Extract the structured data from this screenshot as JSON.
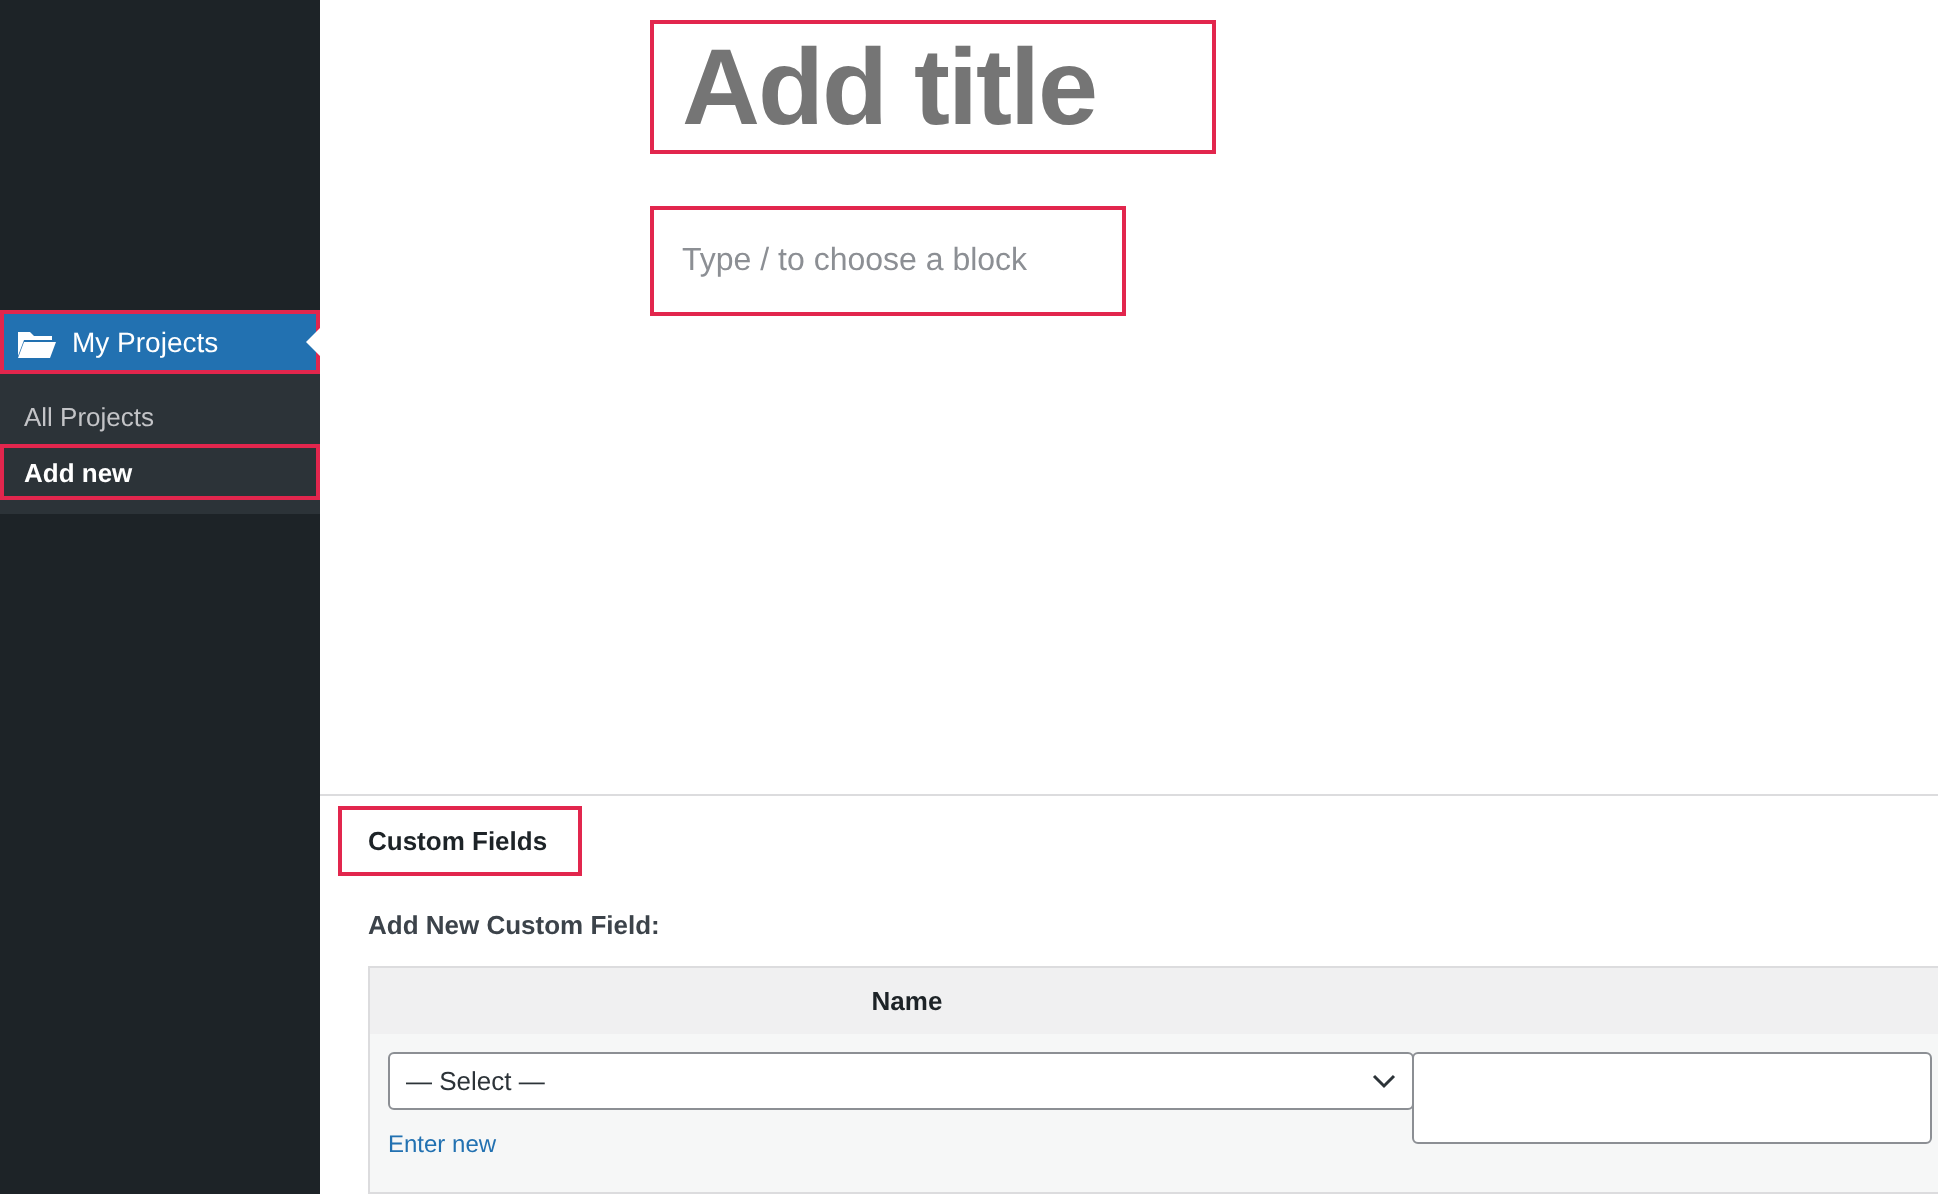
{
  "sidebar": {
    "menu": {
      "label": "My Projects",
      "highlighted": true,
      "submenu": [
        {
          "label": "All Projects",
          "selected": false,
          "highlighted": false
        },
        {
          "label": "Add new",
          "selected": true,
          "highlighted": true
        }
      ]
    }
  },
  "editor": {
    "title": {
      "placeholder": "Add title",
      "highlighted": true
    },
    "block": {
      "placeholder": "Type / to choose a block",
      "highlighted": true
    }
  },
  "custom_fields": {
    "heading": "Custom Fields",
    "highlighted": true,
    "subheading": "Add New Custom Field:",
    "columns": [
      "Name"
    ],
    "select": {
      "value": "— Select —"
    },
    "link": "Enter new"
  }
}
